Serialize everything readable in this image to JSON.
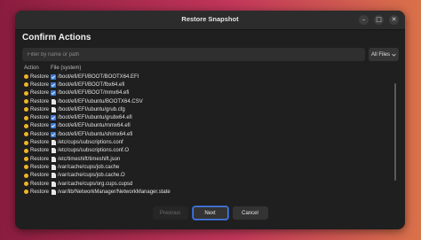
{
  "window": {
    "title": "Restore Snapshot",
    "controls": [
      "–",
      "□",
      "✕"
    ]
  },
  "heading": "Confirm Actions",
  "filter": {
    "placeholder": "Filter by name or path",
    "value": ""
  },
  "dropdown": {
    "selected": "All Files",
    "icon": "chevron-down-icon"
  },
  "table": {
    "headers": [
      "Action",
      "File (system)"
    ],
    "rows": [
      {
        "action": "Restore",
        "type": "checked",
        "path": "/boot/efi/EFI/BOOT/BOOTX64.EFI"
      },
      {
        "action": "Restore",
        "type": "checked",
        "path": "/boot/efi/EFI/BOOT/fbx64.efi"
      },
      {
        "action": "Restore",
        "type": "checked",
        "path": "/boot/efi/EFI/BOOT/mmx64.efi"
      },
      {
        "action": "Restore",
        "type": "file",
        "path": "/boot/efi/EFI/ubuntu/BOOTX64.CSV"
      },
      {
        "action": "Restore",
        "type": "file",
        "path": "/boot/efi/EFI/ubuntu/grub.cfg"
      },
      {
        "action": "Restore",
        "type": "checked",
        "path": "/boot/efi/EFI/ubuntu/grubx64.efi"
      },
      {
        "action": "Restore",
        "type": "checked",
        "path": "/boot/efi/EFI/ubuntu/mmx64.efi"
      },
      {
        "action": "Restore",
        "type": "checked",
        "path": "/boot/efi/EFI/ubuntu/shimx64.efi"
      },
      {
        "action": "Restore",
        "type": "file",
        "path": "/etc/cups/subscriptions.conf"
      },
      {
        "action": "Restore",
        "type": "file",
        "path": "/etc/cups/subscriptions.conf.O"
      },
      {
        "action": "Restore",
        "type": "file",
        "path": "/etc/timeshift/timeshift.json"
      },
      {
        "action": "Restore",
        "type": "file",
        "path": "/var/cache/cups/job.cache"
      },
      {
        "action": "Restore",
        "type": "file",
        "path": "/var/cache/cups/job.cache.O"
      },
      {
        "action": "Restore",
        "type": "file",
        "path": "/var/cache/cups/org.cups.cupsd"
      },
      {
        "action": "Restore",
        "type": "file",
        "path": "/var/lib/NetworkManager/NetworkManager.state"
      }
    ]
  },
  "buttons": {
    "previous": "Previous",
    "next": "Next",
    "cancel": "Cancel"
  },
  "colors": {
    "accent": "#4d7ede",
    "restore_dot": "#f0b429",
    "checked_icon": "#3d7bd9"
  }
}
